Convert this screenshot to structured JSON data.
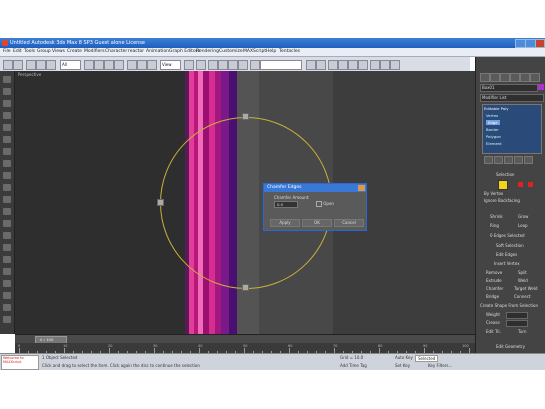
{
  "window": {
    "title": "Untitled    Autodesk 3ds Max 8 SP3    Guest alone License"
  },
  "menubar": {
    "items": [
      "File",
      "Edit",
      "Tools",
      "Group",
      "Views",
      "Create",
      "Modifiers",
      "Character",
      "reactor",
      "Animation",
      "Graph Editors",
      "Rendering",
      "Customize",
      "MAXScript",
      "Help",
      "Tentacles"
    ]
  },
  "toolbar": {
    "selection_filter": "All",
    "view_dropdown": "View"
  },
  "viewport": {
    "label": "Perspective"
  },
  "dialog": {
    "title": "Chamfer Edges",
    "group_label": "Chamfer Amount:",
    "amount_value": "0.0",
    "open_label": "Open",
    "apply_label": "Apply",
    "ok_label": "OK",
    "cancel_label": "Cancel"
  },
  "timeline": {
    "frame_label": "0 / 100"
  },
  "ruler": {
    "ticks": [
      "0",
      "10",
      "20",
      "30",
      "40",
      "50",
      "60",
      "70",
      "80",
      "90",
      "100"
    ]
  },
  "status": {
    "maxscript_line": "Welcome to MAXScript.",
    "objects_selected": "1 Object Selected",
    "prompt": "Click and drag to select the item. Click again the disc to continue the selection",
    "grid": "Grid = 10.0",
    "auto_key": "Auto Key",
    "selected": "Selected",
    "set_key": "Set Key",
    "key_filters": "Key Filters...",
    "add_time_tag": "Add Time Tag"
  },
  "command_panel": {
    "object_name": "Box01",
    "modifier_list": "Modifier List",
    "stack": [
      "Editable Poly",
      "Vertex",
      "Edge",
      "Border",
      "Polygon",
      "Element"
    ],
    "selected_stack_index": 2,
    "rollouts": {
      "selection": "Selection",
      "by_vertex": "By Vertex",
      "ignore_backfacing": "Ignore Backfacing",
      "shrink": "Shrink",
      "grow": "Grow",
      "ring": "Ring",
      "loop": "Loop",
      "edges_selected": "0 Edges Selected",
      "soft_selection": "Soft Selection",
      "edit_edges": "Edit Edges",
      "insert_vertex": "Insert Vertex",
      "remove": "Remove",
      "split": "Split",
      "extrude": "Extrude",
      "weld": "Weld",
      "chamfer": "Chamfer",
      "target_weld": "Target Weld",
      "bridge": "Bridge",
      "connect": "Connect",
      "create_shape": "Create Shape From Selection",
      "weight": "Weight",
      "crease": "Crease",
      "edit_tri": "Edit Tri.",
      "turn": "Turn",
      "edit_geometry": "Edit Geometry"
    }
  },
  "colors": {
    "titlebar": "#1f5fbf",
    "viewport_bg": "#2e2e2e",
    "circle": "#c8b23a",
    "stack_highlight": "#2a4a7a"
  }
}
